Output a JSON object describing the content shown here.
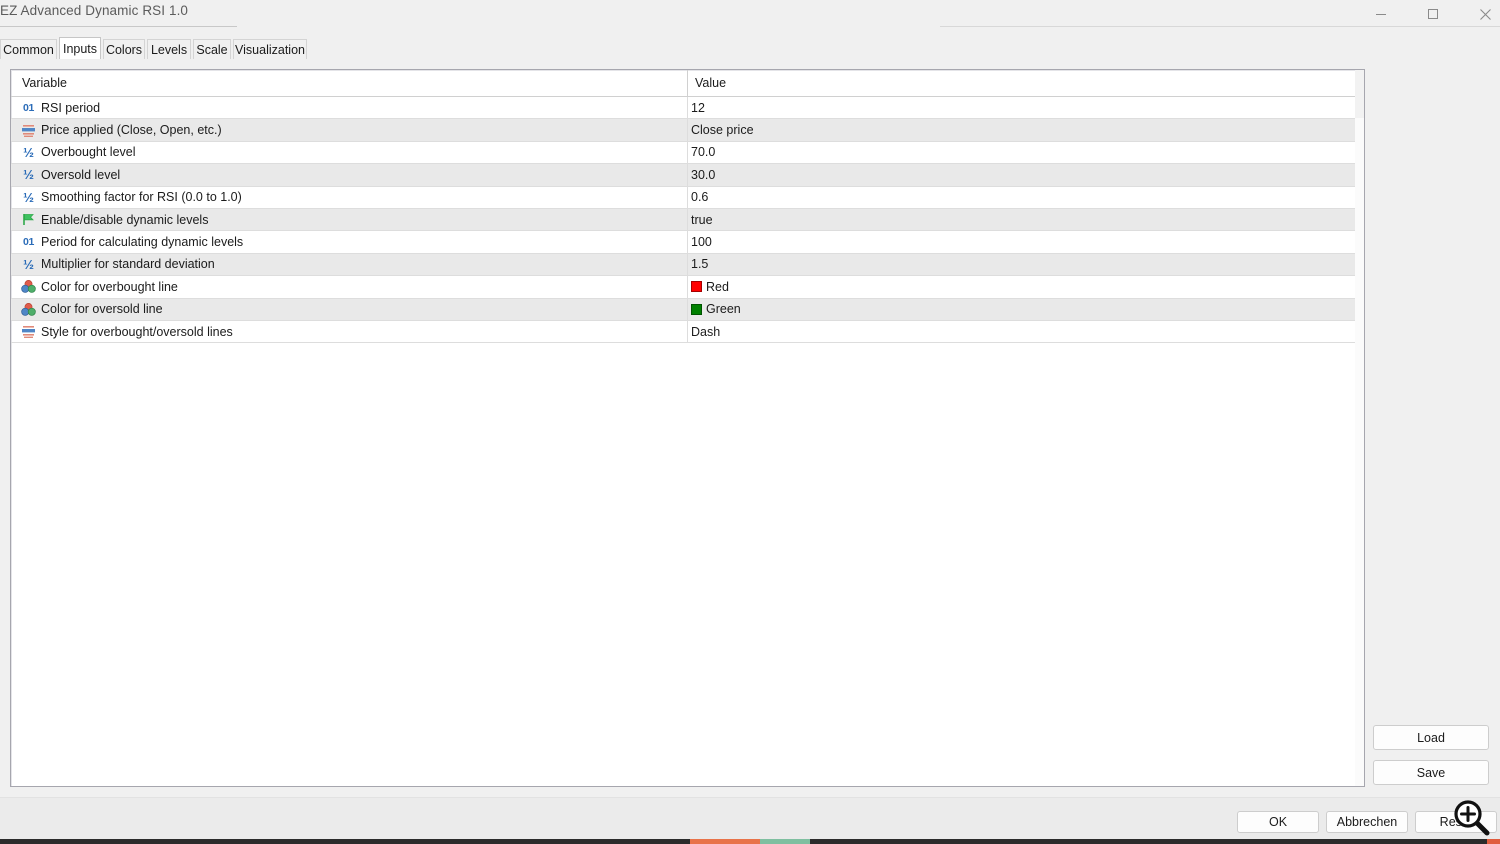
{
  "window": {
    "title": "EZ Advanced Dynamic RSI 1.0",
    "controls": [
      {
        "name": "minimize",
        "glyph": "minimize-icon"
      },
      {
        "name": "maximize",
        "glyph": "maximize-icon"
      },
      {
        "name": "close",
        "glyph": "close-icon"
      }
    ]
  },
  "tabs": [
    {
      "label": "Common",
      "active": false
    },
    {
      "label": "Inputs",
      "active": true
    },
    {
      "label": "Colors",
      "active": false
    },
    {
      "label": "Levels",
      "active": false
    },
    {
      "label": "Scale",
      "active": false
    },
    {
      "label": "Visualization",
      "active": false
    }
  ],
  "table": {
    "headers": {
      "variable": "Variable",
      "value": "Value"
    },
    "rows": [
      {
        "icon": "integer-icon",
        "variable": "RSI period",
        "value": "12"
      },
      {
        "icon": "enum-icon",
        "variable": "Price applied (Close, Open, etc.)",
        "value": "Close price"
      },
      {
        "icon": "double-icon",
        "variable": "Overbought level",
        "value": "70.0"
      },
      {
        "icon": "double-icon",
        "variable": "Oversold level",
        "value": "30.0"
      },
      {
        "icon": "double-icon",
        "variable": "Smoothing factor for RSI (0.0 to 1.0)",
        "value": "0.6"
      },
      {
        "icon": "boolean-icon",
        "variable": "Enable/disable dynamic levels",
        "value": "true"
      },
      {
        "icon": "integer-icon",
        "variable": "Period for calculating dynamic levels",
        "value": "100"
      },
      {
        "icon": "double-icon",
        "variable": "Multiplier for standard deviation",
        "value": "1.5"
      },
      {
        "icon": "color-icon",
        "variable": "Color for overbought line",
        "value": "Red",
        "swatch": "#FF0000"
      },
      {
        "icon": "color-icon",
        "variable": "Color for oversold line",
        "value": "Green",
        "swatch": "#008000"
      },
      {
        "icon": "style-icon",
        "variable": "Style for overbought/oversold lines",
        "value": "Dash"
      }
    ]
  },
  "side_buttons": {
    "load": "Load",
    "save": "Save"
  },
  "footer_buttons": {
    "ok": "OK",
    "cancel": "Abbrechen",
    "reset": "Reset"
  },
  "colors": {
    "accent_blue": "#2b6cb8",
    "row_alt": "#E9E9E9",
    "window_bg": "#F0F0F0",
    "overbought": "#FF0000",
    "oversold": "#008000"
  }
}
